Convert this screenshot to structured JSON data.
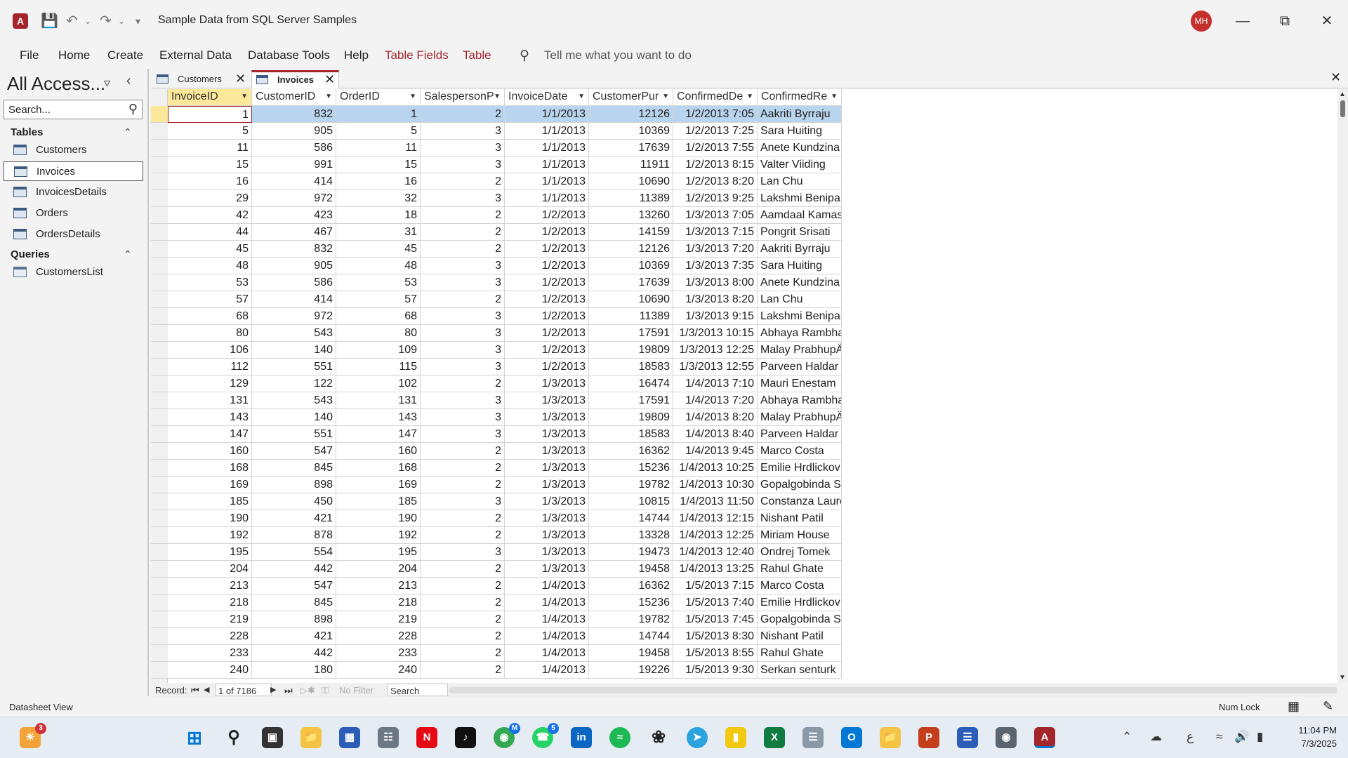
{
  "titlebar": {
    "app_icon_label": "A",
    "save_icon": "save-icon",
    "undo_icon": "undo-icon",
    "redo_icon": "redo-icon",
    "customize_icon": "customize-qat-icon",
    "document_title": "Sample Data from SQL Server Samples",
    "user_initials": "MH"
  },
  "ribbon": {
    "tabs": [
      "File",
      "Home",
      "Create",
      "External Data",
      "Database Tools",
      "Help"
    ],
    "contextual_tabs": [
      "Table Fields",
      "Table"
    ],
    "tell_me": "Tell me what you want to do"
  },
  "nav_pane": {
    "title": "All Access...",
    "search_placeholder": "Search...",
    "groups": [
      {
        "name": "Tables",
        "items": [
          "Customers",
          "Invoices",
          "InvoicesDetails",
          "Orders",
          "OrdersDetails"
        ]
      },
      {
        "name": "Queries",
        "items": [
          "CustomersList"
        ]
      }
    ],
    "selected_item": "Invoices"
  },
  "document_tabs": [
    {
      "label": "Customers",
      "active": false
    },
    {
      "label": "Invoices",
      "active": true
    }
  ],
  "datasheet": {
    "columns": [
      "InvoiceID",
      "CustomerID",
      "OrderID",
      "SalespersonP",
      "InvoiceDate",
      "CustomerPur",
      "ConfirmedDe",
      "ConfirmedRe"
    ],
    "rows": [
      [
        "1",
        "832",
        "1",
        "2",
        "1/1/2013",
        "12126",
        "1/2/2013 7:05",
        "Aakriti Byrraju"
      ],
      [
        "5",
        "905",
        "5",
        "3",
        "1/1/2013",
        "10369",
        "1/2/2013 7:25",
        "Sara Huiting"
      ],
      [
        "11",
        "586",
        "11",
        "3",
        "1/1/2013",
        "17639",
        "1/2/2013 7:55",
        "Anete Kundzina"
      ],
      [
        "15",
        "991",
        "15",
        "3",
        "1/1/2013",
        "11911",
        "1/2/2013 8:15",
        "Valter Viiding"
      ],
      [
        "16",
        "414",
        "16",
        "2",
        "1/1/2013",
        "10690",
        "1/2/2013 8:20",
        "Lan Chu"
      ],
      [
        "29",
        "972",
        "32",
        "3",
        "1/1/2013",
        "11389",
        "1/2/2013 9:25",
        "Lakshmi Benipal"
      ],
      [
        "42",
        "423",
        "18",
        "2",
        "1/2/2013",
        "13260",
        "1/3/2013 7:05",
        "Aamdaal Kamas"
      ],
      [
        "44",
        "467",
        "31",
        "2",
        "1/2/2013",
        "14159",
        "1/3/2013 7:15",
        "Pongrit Srisati"
      ],
      [
        "45",
        "832",
        "45",
        "2",
        "1/2/2013",
        "12126",
        "1/3/2013 7:20",
        "Aakriti Byrraju"
      ],
      [
        "48",
        "905",
        "48",
        "3",
        "1/2/2013",
        "10369",
        "1/3/2013 7:35",
        "Sara Huiting"
      ],
      [
        "53",
        "586",
        "53",
        "3",
        "1/2/2013",
        "17639",
        "1/3/2013 8:00",
        "Anete Kundzina"
      ],
      [
        "57",
        "414",
        "57",
        "2",
        "1/2/2013",
        "10690",
        "1/3/2013 8:20",
        "Lan Chu"
      ],
      [
        "68",
        "972",
        "68",
        "3",
        "1/2/2013",
        "11389",
        "1/3/2013 9:15",
        "Lakshmi Benipal"
      ],
      [
        "80",
        "543",
        "80",
        "3",
        "1/2/2013",
        "17591",
        "1/3/2013 10:15",
        "Abhaya Rambha"
      ],
      [
        "106",
        "140",
        "109",
        "3",
        "1/2/2013",
        "19809",
        "1/3/2013 12:25",
        "Malay PrabhupÄ"
      ],
      [
        "112",
        "551",
        "115",
        "3",
        "1/2/2013",
        "18583",
        "1/3/2013 12:55",
        "Parveen Haldar"
      ],
      [
        "129",
        "122",
        "102",
        "2",
        "1/3/2013",
        "16474",
        "1/4/2013 7:10",
        "Mauri Enestam"
      ],
      [
        "131",
        "543",
        "131",
        "3",
        "1/3/2013",
        "17591",
        "1/4/2013 7:20",
        "Abhaya Rambha"
      ],
      [
        "143",
        "140",
        "143",
        "3",
        "1/3/2013",
        "19809",
        "1/4/2013 8:20",
        "Malay PrabhupÄ"
      ],
      [
        "147",
        "551",
        "147",
        "3",
        "1/3/2013",
        "18583",
        "1/4/2013 8:40",
        "Parveen Haldar"
      ],
      [
        "160",
        "547",
        "160",
        "2",
        "1/3/2013",
        "16362",
        "1/4/2013 9:45",
        "Marco Costa"
      ],
      [
        "168",
        "845",
        "168",
        "2",
        "1/3/2013",
        "15236",
        "1/4/2013 10:25",
        "Emilie Hrdlickov"
      ],
      [
        "169",
        "898",
        "169",
        "2",
        "1/3/2013",
        "19782",
        "1/4/2013 10:30",
        "Gopalgobinda Si"
      ],
      [
        "185",
        "450",
        "185",
        "3",
        "1/3/2013",
        "10815",
        "1/4/2013 11:50",
        "Constanza Laure"
      ],
      [
        "190",
        "421",
        "190",
        "2",
        "1/3/2013",
        "14744",
        "1/4/2013 12:15",
        "Nishant Patil"
      ],
      [
        "192",
        "878",
        "192",
        "2",
        "1/3/2013",
        "13328",
        "1/4/2013 12:25",
        "Miriam House"
      ],
      [
        "195",
        "554",
        "195",
        "3",
        "1/3/2013",
        "19473",
        "1/4/2013 12:40",
        "Ondrej Tomek"
      ],
      [
        "204",
        "442",
        "204",
        "2",
        "1/3/2013",
        "19458",
        "1/4/2013 13:25",
        "Rahul Ghate"
      ],
      [
        "213",
        "547",
        "213",
        "2",
        "1/4/2013",
        "16362",
        "1/5/2013 7:15",
        "Marco Costa"
      ],
      [
        "218",
        "845",
        "218",
        "2",
        "1/4/2013",
        "15236",
        "1/5/2013 7:40",
        "Emilie Hrdlickov"
      ],
      [
        "219",
        "898",
        "219",
        "2",
        "1/4/2013",
        "19782",
        "1/5/2013 7:45",
        "Gopalgobinda Si"
      ],
      [
        "228",
        "421",
        "228",
        "2",
        "1/4/2013",
        "14744",
        "1/5/2013 8:30",
        "Nishant Patil"
      ],
      [
        "233",
        "442",
        "233",
        "2",
        "1/4/2013",
        "19458",
        "1/5/2013 8:55",
        "Rahul Ghate"
      ],
      [
        "240",
        "180",
        "240",
        "2",
        "1/4/2013",
        "19226",
        "1/5/2013 9:30",
        "Serkan senturk"
      ]
    ]
  },
  "record_nav": {
    "label": "Record:",
    "position": "1 of 7186",
    "filter": "No Filter",
    "search": "Search"
  },
  "status_bar": {
    "view": "Datasheet View",
    "num_lock": "Num Lock"
  },
  "taskbar": {
    "weather_badge": "3",
    "chrome_badge": "M",
    "whatsapp_badge": "5",
    "time": "11:04 PM",
    "date": "7/3/2025",
    "lang": "ع"
  },
  "colors": {
    "access_red": "#a4262c",
    "selected_row": "#b9d4ee",
    "active_header": "#fbe89a"
  }
}
